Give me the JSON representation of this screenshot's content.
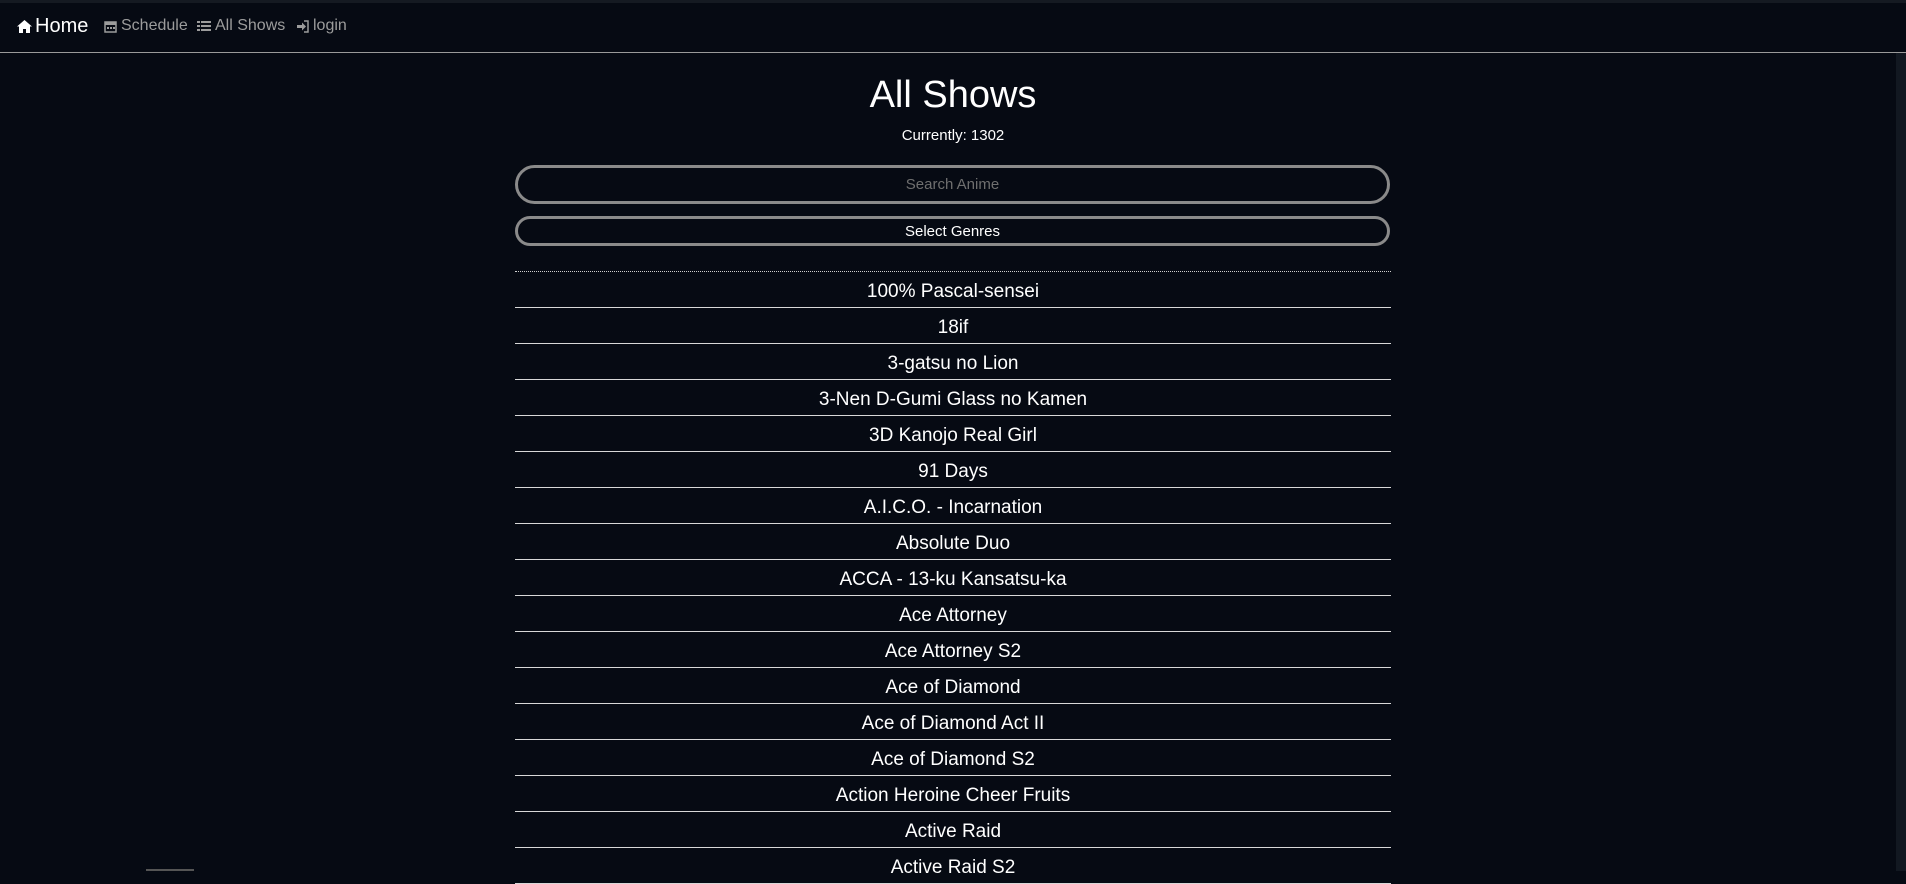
{
  "nav": {
    "home_label": "Home",
    "schedule_label": "Schedule",
    "all_shows_label": "All Shows",
    "login_label": "login",
    "icons": {
      "home": "home-icon",
      "schedule": "calendar-icon",
      "all_shows": "list-icon",
      "login": "sign-in-icon"
    }
  },
  "header": {
    "title": "All Shows",
    "count_text": "Currently: 1302"
  },
  "search": {
    "placeholder": "Search Anime",
    "value": ""
  },
  "genres": {
    "button_label": "Select Genres"
  },
  "shows": [
    "100% Pascal-sensei",
    "18if",
    "3-gatsu no Lion",
    "3-Nen D-Gumi Glass no Kamen",
    "3D Kanojo Real Girl",
    "91 Days",
    "A.I.C.O. - Incarnation",
    "Absolute Duo",
    "ACCA - 13-ku Kansatsu-ka",
    "Ace Attorney",
    "Ace Attorney S2",
    "Ace of Diamond",
    "Ace of Diamond Act II",
    "Ace of Diamond S2",
    "Action Heroine Cheer Fruits",
    "Active Raid",
    "Active Raid S2"
  ],
  "colors": {
    "background": "#060a13",
    "text": "#ffffff",
    "muted": "#9c9c9c",
    "border": "#8a8a8a"
  }
}
